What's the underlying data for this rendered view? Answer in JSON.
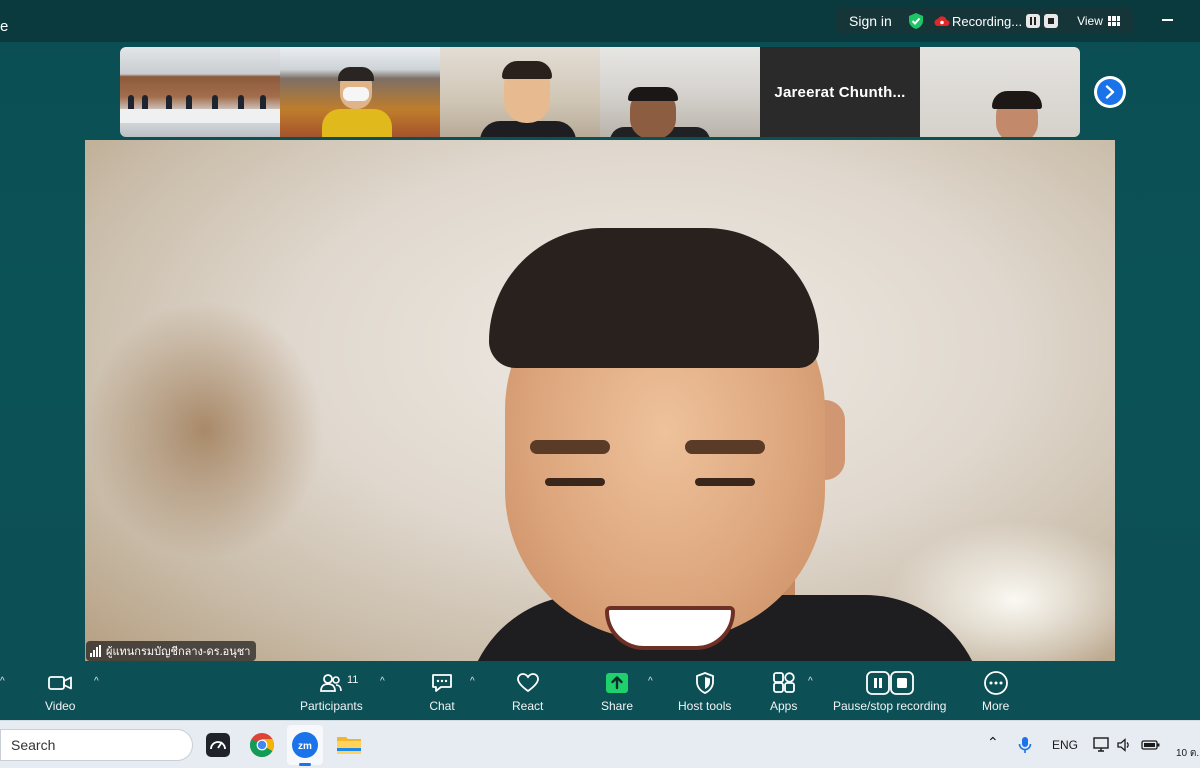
{
  "titlebar": {
    "title_fragment": "e",
    "sign_in": "Sign in",
    "recording_label": "Recording...",
    "view_label": "View"
  },
  "gallery": {
    "thumbnails": [
      {
        "kind": "video",
        "desc": "conference-room"
      },
      {
        "kind": "video",
        "desc": "masked-participant"
      },
      {
        "kind": "video",
        "desc": "smiling-participant"
      },
      {
        "kind": "video",
        "desc": "participant-with-glasses"
      },
      {
        "kind": "name",
        "name": "Jareerat  Chunth..."
      },
      {
        "kind": "video",
        "desc": "participant-woman"
      }
    ]
  },
  "main_video": {
    "speaker_name": "ผู้แทนกรมบัญชีกลาง-ดร.อนุชา"
  },
  "toolbar": {
    "video": "Video",
    "participants": "Participants",
    "participants_count": "11",
    "chat": "Chat",
    "react": "React",
    "share": "Share",
    "host_tools": "Host tools",
    "apps": "Apps",
    "pause_stop": "Pause/stop recording",
    "more": "More"
  },
  "taskbar": {
    "search_placeholder": "Search",
    "language": "ENG",
    "clock_fragment": "10 ต."
  },
  "colors": {
    "accent_blue": "#1a73e8",
    "share_green": "#1fd16a",
    "shield_green": "#1fc466",
    "record_red": "#e02828"
  }
}
